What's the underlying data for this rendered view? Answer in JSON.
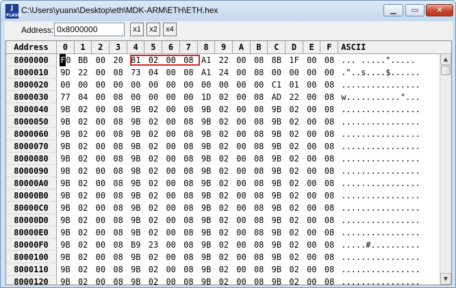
{
  "window": {
    "title": "C:\\Users\\yuanx\\Desktop\\eth\\MDK-ARM\\ETH\\ETH.hex",
    "app_icon_text": "J\nFLASH"
  },
  "toolbar": {
    "address_label": "Address:",
    "address_value": "0x8000000",
    "x1": "x1",
    "x2": "x2",
    "x4": "x4"
  },
  "grid": {
    "header": {
      "address": "Address",
      "columns": [
        "0",
        "1",
        "2",
        "3",
        "4",
        "5",
        "6",
        "7",
        "8",
        "9",
        "A",
        "B",
        "C",
        "D",
        "E",
        "F"
      ],
      "ascii": "ASCII"
    },
    "highlight_color": "#d62020",
    "rows": [
      {
        "addr": "8000000",
        "bytes": [
          "F0",
          "BB",
          "00",
          "20",
          "81",
          "02",
          "00",
          "08",
          "A1",
          "22",
          "00",
          "08",
          "8B",
          "1F",
          "00",
          "08"
        ],
        "ascii": "... .....\"....."
      },
      {
        "addr": "8000010",
        "bytes": [
          "9D",
          "22",
          "00",
          "08",
          "73",
          "04",
          "00",
          "08",
          "A1",
          "24",
          "00",
          "08",
          "00",
          "00",
          "00",
          "00"
        ],
        "ascii": ".\"..s....$......"
      },
      {
        "addr": "8000020",
        "bytes": [
          "00",
          "00",
          "00",
          "00",
          "00",
          "00",
          "00",
          "00",
          "00",
          "00",
          "00",
          "00",
          "C1",
          "01",
          "00",
          "08"
        ],
        "ascii": "................"
      },
      {
        "addr": "8000030",
        "bytes": [
          "77",
          "04",
          "00",
          "08",
          "00",
          "00",
          "00",
          "00",
          "1D",
          "02",
          "00",
          "08",
          "AD",
          "22",
          "00",
          "08"
        ],
        "ascii": "w...........\"..."
      },
      {
        "addr": "8000040",
        "bytes": [
          "9B",
          "02",
          "00",
          "08",
          "9B",
          "02",
          "00",
          "08",
          "9B",
          "02",
          "00",
          "08",
          "9B",
          "02",
          "00",
          "08"
        ],
        "ascii": "................"
      },
      {
        "addr": "8000050",
        "bytes": [
          "9B",
          "02",
          "00",
          "08",
          "9B",
          "02",
          "00",
          "08",
          "9B",
          "02",
          "00",
          "08",
          "9B",
          "02",
          "00",
          "08"
        ],
        "ascii": "................"
      },
      {
        "addr": "8000060",
        "bytes": [
          "9B",
          "02",
          "00",
          "08",
          "9B",
          "02",
          "00",
          "08",
          "9B",
          "02",
          "00",
          "08",
          "9B",
          "02",
          "00",
          "08"
        ],
        "ascii": "................"
      },
      {
        "addr": "8000070",
        "bytes": [
          "9B",
          "02",
          "00",
          "08",
          "9B",
          "02",
          "00",
          "08",
          "9B",
          "02",
          "00",
          "08",
          "9B",
          "02",
          "00",
          "08"
        ],
        "ascii": "................"
      },
      {
        "addr": "8000080",
        "bytes": [
          "9B",
          "02",
          "00",
          "08",
          "9B",
          "02",
          "00",
          "08",
          "9B",
          "02",
          "00",
          "08",
          "9B",
          "02",
          "00",
          "08"
        ],
        "ascii": "................"
      },
      {
        "addr": "8000090",
        "bytes": [
          "9B",
          "02",
          "00",
          "08",
          "9B",
          "02",
          "00",
          "08",
          "9B",
          "02",
          "00",
          "08",
          "9B",
          "02",
          "00",
          "08"
        ],
        "ascii": "................"
      },
      {
        "addr": "80000A0",
        "bytes": [
          "9B",
          "02",
          "00",
          "08",
          "9B",
          "02",
          "00",
          "08",
          "9B",
          "02",
          "00",
          "08",
          "9B",
          "02",
          "00",
          "08"
        ],
        "ascii": "................"
      },
      {
        "addr": "80000B0",
        "bytes": [
          "9B",
          "02",
          "00",
          "08",
          "9B",
          "02",
          "00",
          "08",
          "9B",
          "02",
          "00",
          "08",
          "9B",
          "02",
          "00",
          "08"
        ],
        "ascii": "................"
      },
      {
        "addr": "80000C0",
        "bytes": [
          "9B",
          "02",
          "00",
          "08",
          "9B",
          "02",
          "00",
          "08",
          "9B",
          "02",
          "00",
          "08",
          "9B",
          "02",
          "00",
          "08"
        ],
        "ascii": "................"
      },
      {
        "addr": "80000D0",
        "bytes": [
          "9B",
          "02",
          "00",
          "08",
          "9B",
          "02",
          "00",
          "08",
          "9B",
          "02",
          "00",
          "08",
          "9B",
          "02",
          "00",
          "08"
        ],
        "ascii": "................"
      },
      {
        "addr": "80000E0",
        "bytes": [
          "9B",
          "02",
          "00",
          "08",
          "9B",
          "02",
          "00",
          "08",
          "9B",
          "02",
          "00",
          "08",
          "9B",
          "02",
          "00",
          "08"
        ],
        "ascii": "................"
      },
      {
        "addr": "80000F0",
        "bytes": [
          "9B",
          "02",
          "00",
          "08",
          "B9",
          "23",
          "00",
          "08",
          "9B",
          "02",
          "00",
          "08",
          "9B",
          "02",
          "00",
          "08"
        ],
        "ascii": ".....#.........."
      },
      {
        "addr": "8000100",
        "bytes": [
          "9B",
          "02",
          "00",
          "08",
          "9B",
          "02",
          "00",
          "08",
          "9B",
          "02",
          "00",
          "08",
          "9B",
          "02",
          "00",
          "08"
        ],
        "ascii": "................"
      },
      {
        "addr": "8000110",
        "bytes": [
          "9B",
          "02",
          "00",
          "08",
          "9B",
          "02",
          "00",
          "08",
          "9B",
          "02",
          "00",
          "08",
          "9B",
          "02",
          "00",
          "08"
        ],
        "ascii": "................"
      },
      {
        "addr": "8000120",
        "bytes": [
          "9B",
          "02",
          "00",
          "08",
          "9B",
          "02",
          "00",
          "08",
          "9B",
          "02",
          "00",
          "08",
          "9B",
          "02",
          "00",
          "08"
        ],
        "ascii": "................"
      }
    ]
  }
}
